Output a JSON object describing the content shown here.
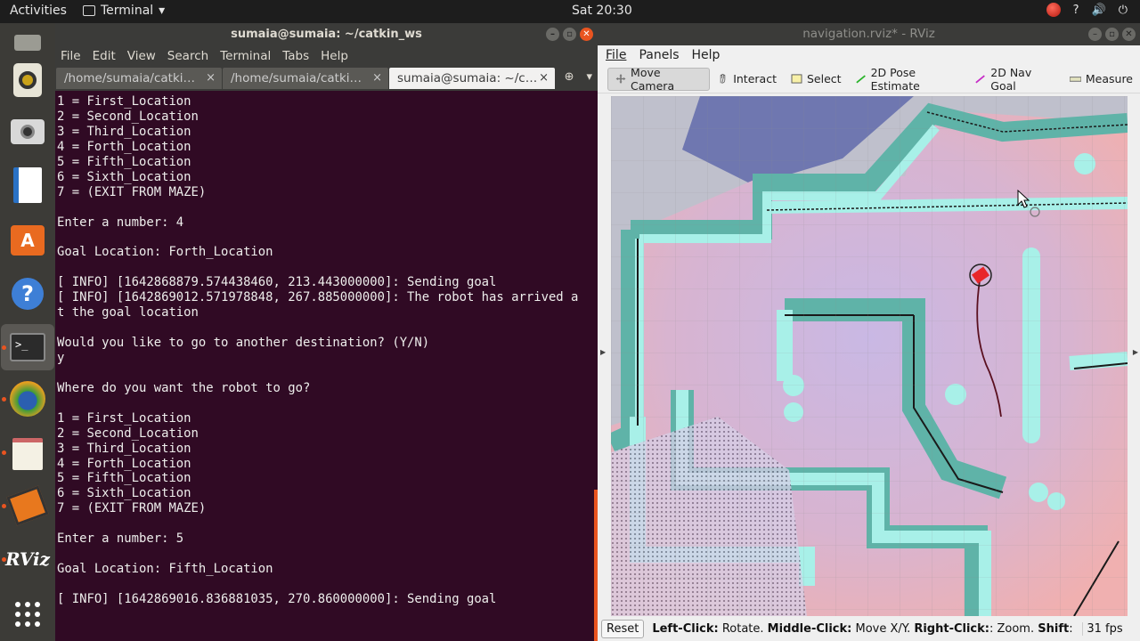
{
  "topbar": {
    "activities": "Activities",
    "app_name": "Terminal",
    "clock": "Sat 20:30",
    "tray_help": "?",
    "tray_volume": "🔊",
    "tray_power": "⏻"
  },
  "terminal": {
    "title": "sumaia@sumaia: ~/catkin_ws",
    "menu": [
      "File",
      "Edit",
      "View",
      "Search",
      "Terminal",
      "Tabs",
      "Help"
    ],
    "tabs": [
      {
        "label": "/home/sumaia/catki…"
      },
      {
        "label": "/home/sumaia/catki…"
      },
      {
        "label": "sumaia@sumaia: ~/c…"
      }
    ],
    "lines": [
      "1 = First_Location",
      "2 = Second_Location",
      "3 = Third_Location",
      "4 = Forth_Location",
      "5 = Fifth_Location",
      "6 = Sixth_Location",
      "7 = (EXIT FROM MAZE)",
      "",
      "Enter a number: 4",
      "",
      "Goal Location: Forth_Location",
      "",
      "[ INFO] [1642868879.574438460, 213.443000000]: Sending goal",
      "[ INFO] [1642869012.571978848, 267.885000000]: The robot has arrived a",
      "t the goal location",
      "",
      "Would you like to go to another destination? (Y/N)",
      "y",
      "",
      "Where do you want the robot to go?",
      "",
      "1 = First_Location",
      "2 = Second_Location",
      "3 = Third_Location",
      "4 = Forth_Location",
      "5 = Fifth_Location",
      "6 = Sixth_Location",
      "7 = (EXIT FROM MAZE)",
      "",
      "Enter a number: 5",
      "",
      "Goal Location: Fifth_Location",
      "",
      "[ INFO] [1642869016.836881035, 270.860000000]: Sending goal"
    ]
  },
  "rviz": {
    "title": "navigation.rviz* - RViz",
    "menu": [
      "File",
      "Panels",
      "Help"
    ],
    "tools": [
      "Move Camera",
      "Interact",
      "Select",
      "2D Pose Estimate",
      "2D Nav Goal",
      "Measure"
    ],
    "status": {
      "reset": "Reset",
      "help_parts": [
        {
          "bold": "Left-Click:",
          "text": " Rotate. "
        },
        {
          "bold": "Middle-Click:",
          "text": " Move X/Y. "
        },
        {
          "bold": "Right-Click:",
          "text": ": Zoom. "
        },
        {
          "bold": "Shift",
          "text": ": More "
        }
      ],
      "fps": "31 fps"
    },
    "colors": {
      "wall_teal": "#5fb3a8",
      "free_pink": "#f0c4c8",
      "unknown_blue": "#6f77b0",
      "inflation_cyan": "#a8f0e8",
      "robot_red": "#e8262a"
    }
  },
  "dock": [
    "files",
    "rhythmbox",
    "camera",
    "writer",
    "software",
    "help",
    "terminal",
    "browser",
    "text-editor",
    "package",
    "rviz",
    "apps"
  ]
}
